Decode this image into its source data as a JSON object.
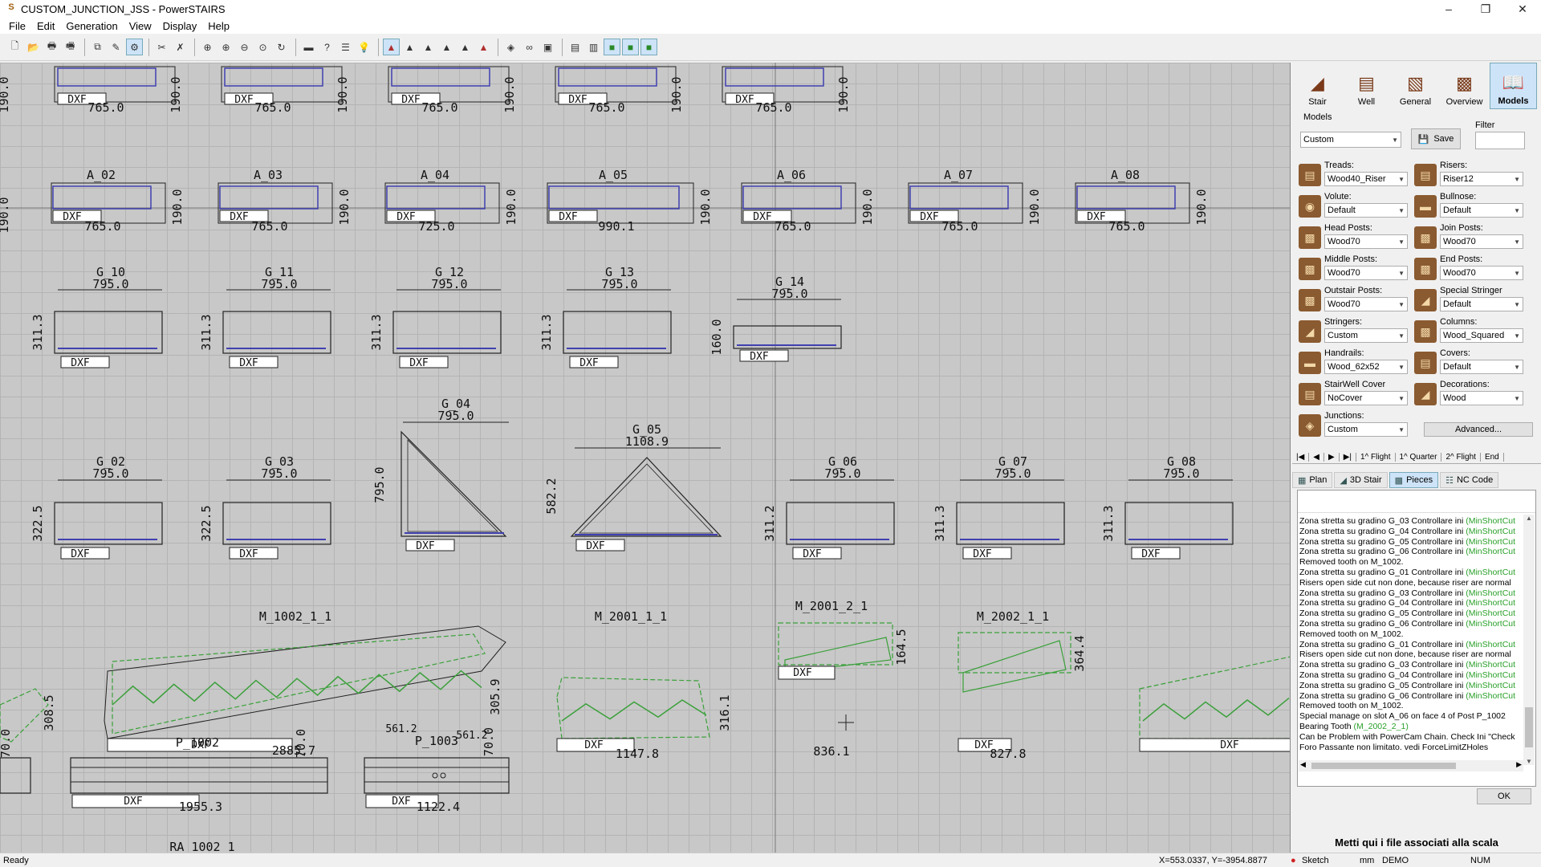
{
  "window": {
    "title": "CUSTOM_JUNCTION_JSS - PowerSTAIRS",
    "app_icon": "powerstairs-icon"
  },
  "menu": [
    "File",
    "Edit",
    "Generation",
    "View",
    "Display",
    "Help"
  ],
  "canvas": {
    "dims_top": [
      "765.0",
      "765.0",
      "765.0",
      "765.0",
      "765.0"
    ],
    "dim_190": "190.0",
    "a_parts": [
      {
        "name": "A_02",
        "w": "765.0"
      },
      {
        "name": "A_03",
        "w": "765.0"
      },
      {
        "name": "A_04",
        "w": "725.0"
      },
      {
        "name": "A_05",
        "w": "990.1"
      },
      {
        "name": "A_06",
        "w": "765.0"
      },
      {
        "name": "A_07",
        "w": "765.0"
      },
      {
        "name": "A_08",
        "w": "765.0"
      }
    ],
    "g_row1": [
      {
        "name": "G_10",
        "w": "795.0",
        "h": "311.3"
      },
      {
        "name": "G_11",
        "w": "795.0",
        "h": "311.3"
      },
      {
        "name": "G_12",
        "w": "795.0",
        "h": "311.3"
      },
      {
        "name": "G_13",
        "w": "795.0",
        "h": "311.3"
      },
      {
        "name": "G_14",
        "w": "795.0",
        "h": "160.0"
      }
    ],
    "g_row2": [
      {
        "name": "G_02",
        "w": "795.0",
        "h": "322.5"
      },
      {
        "name": "G_03",
        "w": "795.0",
        "h": "322.5"
      },
      {
        "name": "G_04",
        "w": "795.0",
        "h": "795.0"
      },
      {
        "name": "G_05",
        "w": "1108.9",
        "h": "582.2"
      },
      {
        "name": "G_06",
        "w": "795.0",
        "h": "311.2"
      },
      {
        "name": "G_07",
        "w": "795.0",
        "h": "311.3"
      },
      {
        "name": "G_08",
        "w": "795.0",
        "h": "311.3"
      }
    ],
    "stringers": [
      {
        "name": "M_1002_1_1",
        "w": "2885.7",
        "h": "305.9"
      },
      {
        "name": "M_2001_1_1",
        "w": "1147.8",
        "h": "316.1"
      },
      {
        "name": "M_2001_2_1",
        "w": "836.1",
        "h": "164.5"
      },
      {
        "name": "M_2002_1_1",
        "w": "827.8",
        "h": "364.4"
      }
    ],
    "left_dim": "308.5",
    "posts": [
      {
        "name": "P_1002",
        "w": "1955.3",
        "h": "70.0"
      },
      {
        "name": "P_1003",
        "w": "1122.4",
        "h": "70.0",
        "d1": "561.2",
        "d2": "561.2"
      }
    ],
    "bottom_label": "RA_1002_1",
    "dxf": "DXF"
  },
  "panel": {
    "tabs": [
      {
        "label": "Stair",
        "icon": "stair-icon"
      },
      {
        "label": "Well",
        "icon": "well-icon"
      },
      {
        "label": "General",
        "icon": "general-icon"
      },
      {
        "label": "Overview",
        "icon": "overview-icon"
      },
      {
        "label": "Models",
        "icon": "models-icon"
      }
    ],
    "models_label": "Models",
    "models_value": "Custom",
    "save_label": "Save",
    "filter_label": "Filter",
    "filter_value": "",
    "fields": [
      {
        "label": "Treads:",
        "value": "Wood40_Riser",
        "icon": "treads-icon"
      },
      {
        "label": "Risers:",
        "value": "Riser12",
        "icon": "risers-icon"
      },
      {
        "label": "Volute:",
        "value": "Default",
        "icon": "volute-icon"
      },
      {
        "label": "Bullnose:",
        "value": "Default",
        "icon": "bullnose-icon"
      },
      {
        "label": "Head Posts:",
        "value": "Wood70",
        "icon": "head-posts-icon"
      },
      {
        "label": "Join Posts:",
        "value": "Wood70",
        "icon": "join-posts-icon"
      },
      {
        "label": "Middle Posts:",
        "value": "Wood70",
        "icon": "middle-posts-icon"
      },
      {
        "label": "End Posts:",
        "value": "Wood70",
        "icon": "end-posts-icon"
      },
      {
        "label": "Outstair Posts:",
        "value": "Wood70",
        "icon": "outstair-posts-icon"
      },
      {
        "label": "Special Stringer",
        "value": "Default",
        "icon": "special-stringer-icon"
      },
      {
        "label": "Stringers:",
        "value": "Custom",
        "icon": "stringers-icon"
      },
      {
        "label": "Columns:",
        "value": "Wood_Squared",
        "icon": "columns-icon"
      },
      {
        "label": "Handrails:",
        "value": "Wood_62x52",
        "icon": "handrails-icon"
      },
      {
        "label": "Covers:",
        "value": "Default",
        "icon": "covers-icon"
      },
      {
        "label": "StairWell Cover",
        "value": "NoCover",
        "icon": "stairwell-cover-icon"
      },
      {
        "label": "Decorations:",
        "value": "Wood",
        "icon": "decorations-icon"
      },
      {
        "label": "Junctions:",
        "value": "Custom",
        "icon": "junctions-icon"
      }
    ],
    "advanced_label": "Advanced...",
    "flight_nav": [
      "1^ Flight",
      "1^ Quarter",
      "2^ Flight",
      "End"
    ],
    "view_tabs": [
      {
        "label": "Plan",
        "icon": "plan-icon"
      },
      {
        "label": "3D Stair",
        "icon": "3d-stair-icon"
      },
      {
        "label": "Pieces",
        "icon": "pieces-icon"
      },
      {
        "label": "NC Code",
        "icon": "nc-code-icon"
      }
    ],
    "messages": [
      {
        "t": "Zona stretta su gradino G_03 Controllare ini ",
        "h": "(MinShortCut"
      },
      {
        "t": "Zona stretta su gradino G_04 Controllare ini ",
        "h": "(MinShortCut"
      },
      {
        "t": "Zona stretta su gradino G_05 Controllare ini ",
        "h": "(MinShortCut"
      },
      {
        "t": "Zona stretta su gradino G_06 Controllare ini ",
        "h": "(MinShortCut"
      },
      {
        "t": "Removed tooth on  M_1002.",
        "h": ""
      },
      {
        "t": "Zona stretta su gradino G_01 Controllare ini ",
        "h": "(MinShortCut"
      },
      {
        "t": "Risers open side cut non done, because riser are normal",
        "h": ""
      },
      {
        "t": "Zona stretta su gradino G_03 Controllare ini ",
        "h": "(MinShortCut"
      },
      {
        "t": "Zona stretta su gradino G_04 Controllare ini ",
        "h": "(MinShortCut"
      },
      {
        "t": "Zona stretta su gradino G_05 Controllare ini ",
        "h": "(MinShortCut"
      },
      {
        "t": "Zona stretta su gradino G_06 Controllare ini ",
        "h": "(MinShortCut"
      },
      {
        "t": "Removed tooth on  M_1002.",
        "h": ""
      },
      {
        "t": "Zona stretta su gradino G_01 Controllare ini ",
        "h": "(MinShortCut"
      },
      {
        "t": "Risers open side cut non done, because riser are normal",
        "h": ""
      },
      {
        "t": "Zona stretta su gradino G_03 Controllare ini ",
        "h": "(MinShortCut"
      },
      {
        "t": "Zona stretta su gradino G_04 Controllare ini ",
        "h": "(MinShortCut"
      },
      {
        "t": "Zona stretta su gradino G_05 Controllare ini ",
        "h": "(MinShortCut"
      },
      {
        "t": "Zona stretta su gradino G_06 Controllare ini ",
        "h": "(MinShortCut"
      },
      {
        "t": "Removed tooth on  M_1002.",
        "h": ""
      },
      {
        "t": "Special manage on slot A_06 on face 4 of Post P_1002",
        "h": ""
      },
      {
        "t": "Bearing Tooth ",
        "h": "(M_2002_2_1)"
      },
      {
        "t": "Can be Problem with PowerCam Chain. Check Ini \"Check",
        "h": ""
      },
      {
        "t": "Foro Passante non limitato. vedi ForceLimitZHoles",
        "h": ""
      }
    ],
    "ok_label": "OK",
    "dropzone": "Metti qui i file associati alla scala"
  },
  "status": {
    "left": "Ready",
    "coords": "X=553.0337, Y=-3954.8877",
    "mode": "Sketch",
    "units": "mm",
    "license": "DEMO",
    "num": "NUM"
  },
  "colors": {
    "canvas_bg": "#c8c8c8",
    "grid": "#b4b4b4",
    "part_line": "#222222",
    "blue_line": "#4040b0",
    "green_line": "#3aa03a",
    "selected_tab": "#cde3f7"
  }
}
